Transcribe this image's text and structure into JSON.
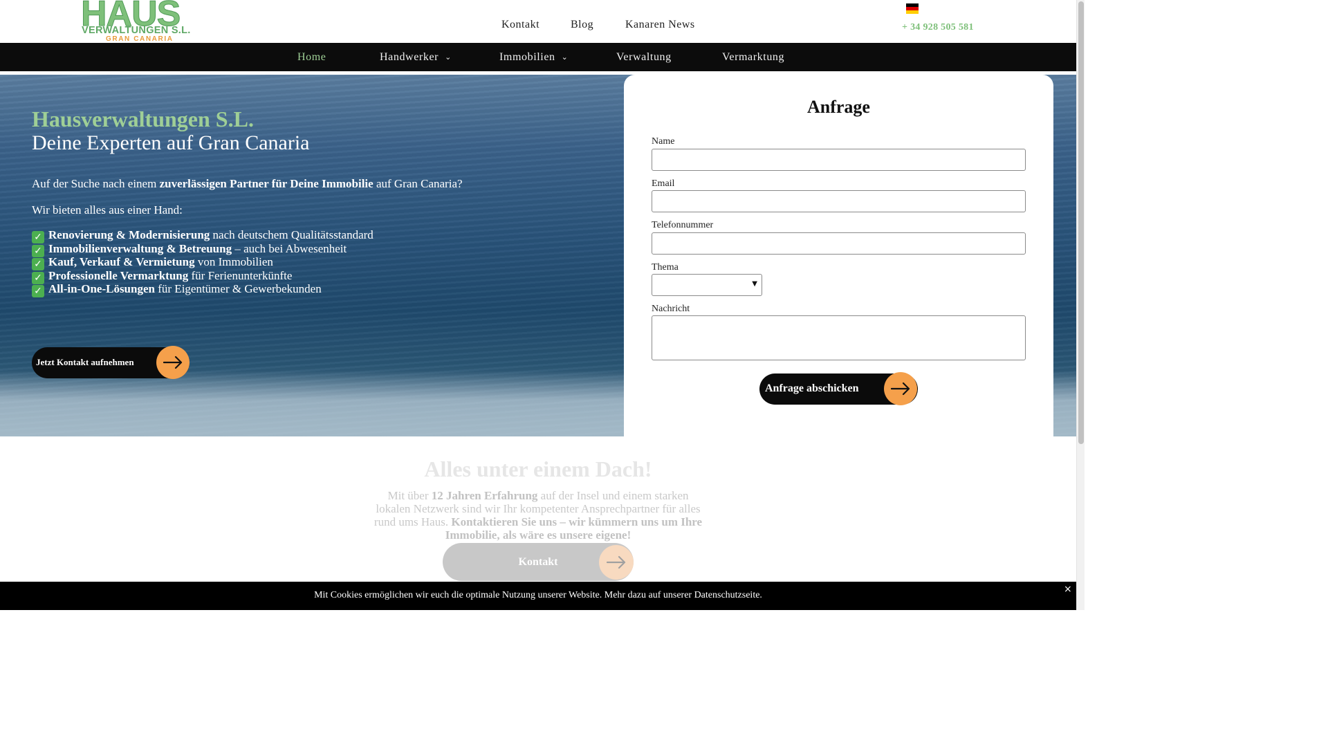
{
  "logo": {
    "line1": "HAUS",
    "line2": "VERWALTUNGEN S.L.",
    "line3": "GRAN CANARIA"
  },
  "topnav": [
    "Kontakt",
    "Blog",
    "Kanaren News"
  ],
  "language_icon": "german-flag-icon",
  "phone": "+ 34 928 505 581",
  "mainnav": {
    "items": [
      "Home",
      "Handwerker",
      "Immobilien",
      "Verwaltung",
      "Vermarktung"
    ],
    "active": "Home",
    "caret_glyph": "⌄"
  },
  "hero": {
    "title": "Hausverwaltungen S.L.",
    "subtitle": "Deine Experten auf Gran Canaria",
    "intro_pre": "Auf der Suche nach einem ",
    "intro_bold": "zuverlässigen Partner für Deine Immobilie",
    "intro_post": " auf Gran Canaria?",
    "lead": "Wir bieten alles aus einer Hand:",
    "check_glyph": "✓",
    "benefits": [
      {
        "bold": "Renovierung & Modernisierung",
        "rest": " nach deutschem Qualitätsstandard"
      },
      {
        "bold": "Immobilienverwaltung & Betreuung",
        "rest": " – auch bei Abwesenheit"
      },
      {
        "bold": "Kauf, Verkauf & Vermietung",
        "rest": " von Immobilien"
      },
      {
        "bold": "Professionelle Vermarktung",
        "rest": " für Ferienunterkünfte"
      },
      {
        "bold": "All-in-One-Lösungen",
        "rest": " für Eigentümer & Gewerbekunden"
      }
    ],
    "cta_label": "Jetzt Kontakt aufnehmen"
  },
  "form": {
    "title": "Anfrage",
    "fields": {
      "name": {
        "label": "Name",
        "value": ""
      },
      "email": {
        "label": "Email",
        "value": ""
      },
      "phone": {
        "label": "Telefonnummer",
        "value": ""
      },
      "topic": {
        "label": "Thema",
        "value": ""
      },
      "message": {
        "label": "Nachricht",
        "value": ""
      }
    },
    "select_glyph": "▼",
    "submit_label": "Anfrage abschicken"
  },
  "section2": {
    "title": "Alles unter einem Dach!",
    "t1": "Mit über ",
    "b1": "12 Jahren Erfahrung",
    "t2": " auf der Insel und einem starken lokalen Netzwerk sind wir Ihr kompetenter Ansprechpartner für alles rund ums Haus. ",
    "b2": "Kontaktieren Sie uns – wir kümmern uns um Ihre Immobilie, als wäre es unsere eigene!",
    "button_label": "Kontakt"
  },
  "cookie": {
    "message": "Mit Cookies ermöglichen wir euch die optimale Nutzung unserer Website. Mehr dazu auf unserer Datenschutzseite.",
    "close": "×"
  },
  "colors": {
    "brand_green": "#9fcf96",
    "accent_orange": "#f5a04b",
    "nav_bg": "#0c0c0c"
  }
}
